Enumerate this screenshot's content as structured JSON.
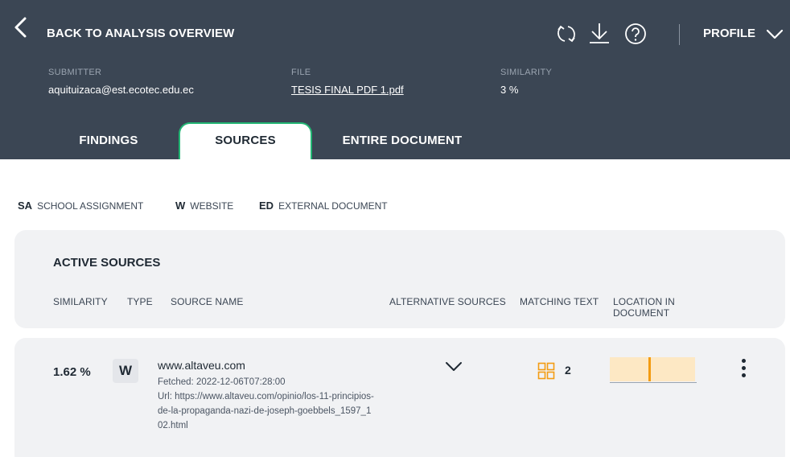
{
  "topbar": {
    "back_label": "BACK TO ANALYSIS OVERVIEW",
    "icons": [
      "chevron-left-icon",
      "refresh-icon",
      "download-icon",
      "help-icon",
      "chevron-down-icon"
    ],
    "profile_label": "PROFILE"
  },
  "meta": {
    "submitter_label": "SUBMITTER",
    "submitter_value": "aquituizaca@est.ecotec.edu.ec",
    "file_label": "FILE",
    "file_value": "TESIS FINAL PDF 1.pdf",
    "similarity_label": "SIMILARITY",
    "similarity_value": "3 %"
  },
  "tabs": [
    {
      "label": "FINDINGS",
      "active": false
    },
    {
      "label": "SOURCES",
      "active": true
    },
    {
      "label": "ENTIRE DOCUMENT",
      "active": false
    }
  ],
  "legend": [
    {
      "abbr": "SA",
      "label": "SCHOOL ASSIGNMENT"
    },
    {
      "abbr": "W",
      "label": "WEBSITE"
    },
    {
      "abbr": "ED",
      "label": "EXTERNAL DOCUMENT"
    }
  ],
  "sources": {
    "title": "ACTIVE SOURCES",
    "columns": [
      "SIMILARITY",
      "TYPE",
      "SOURCE NAME",
      "ALTERNATIVE SOURCES",
      "MATCHING TEXT",
      "LOCATION IN DOCUMENT"
    ],
    "rows": [
      {
        "similarity": "1.62 %",
        "type": "W",
        "name": "www.altaveu.com",
        "fetched": "Fetched: 2022-12-06T07:28:00",
        "url": "Url: https://www.altaveu.com/opinio/los-11-principios-de-la-propaganda-nazi-de-joseph-goebbels_1597_102.html",
        "matching_count": "2",
        "location_fraction": 0.45
      }
    ]
  },
  "colors": {
    "header_bg": "#3b4654",
    "active_tab_border": "#22b573",
    "card_bg": "#f1f2f4",
    "location_bg": "#fde8c4",
    "location_mark": "#f39c12",
    "match_icon": "#f39c12"
  }
}
